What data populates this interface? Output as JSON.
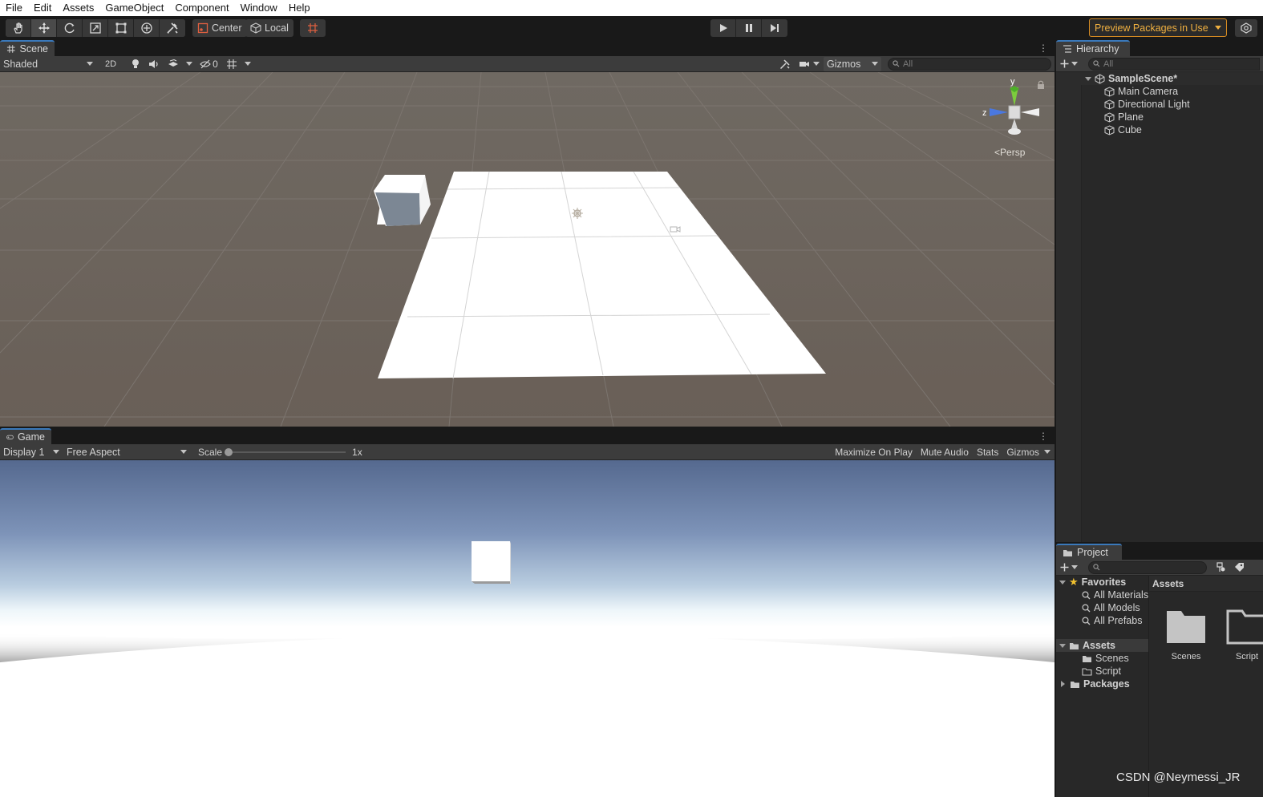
{
  "menu": [
    "File",
    "Edit",
    "Assets",
    "GameObject",
    "Component",
    "Window",
    "Help"
  ],
  "toolbar": {
    "pivot_label": "Center",
    "space_label": "Local",
    "preview_packages_label": "Preview Packages in Use"
  },
  "scene": {
    "tab_label": "Scene",
    "shading_mode": "Shaded",
    "mode_2d": "2D",
    "hidden_count": "0",
    "gizmos_label": "Gizmos",
    "search_placeholder": "All",
    "gizmo_axis_y": "y",
    "gizmo_axis_z": "z",
    "projection_label": "Persp"
  },
  "game": {
    "tab_label": "Game",
    "display": "Display 1",
    "aspect": "Free Aspect",
    "scale_label": "Scale",
    "scale_value": "1x",
    "scale_slider_level": 0,
    "maximize_label": "Maximize On Play",
    "mute_label": "Mute Audio",
    "stats_label": "Stats",
    "gizmos_label": "Gizmos"
  },
  "hierarchy": {
    "tab_label": "Hierarchy",
    "search_placeholder": "All",
    "scene_name": "SampleScene*",
    "objects": [
      "Main Camera",
      "Directional Light",
      "Plane",
      "Cube"
    ]
  },
  "project": {
    "tab_label": "Project",
    "favorites_label": "Favorites",
    "favorites": [
      "All Materials",
      "All Models",
      "All Prefabs"
    ],
    "assets_label": "Assets",
    "asset_folders": [
      "Scenes",
      "Script"
    ],
    "packages_label": "Packages",
    "breadcrumb": "Assets",
    "grid_items": [
      "Scenes",
      "Script"
    ]
  },
  "watermark": "CSDN @Neymessi_JR",
  "colors": {
    "accent_blue": "#3a79bb",
    "preview_orange": "#f0b040",
    "scene_ground": "#6a625b",
    "sky_top": "#5a7098"
  }
}
